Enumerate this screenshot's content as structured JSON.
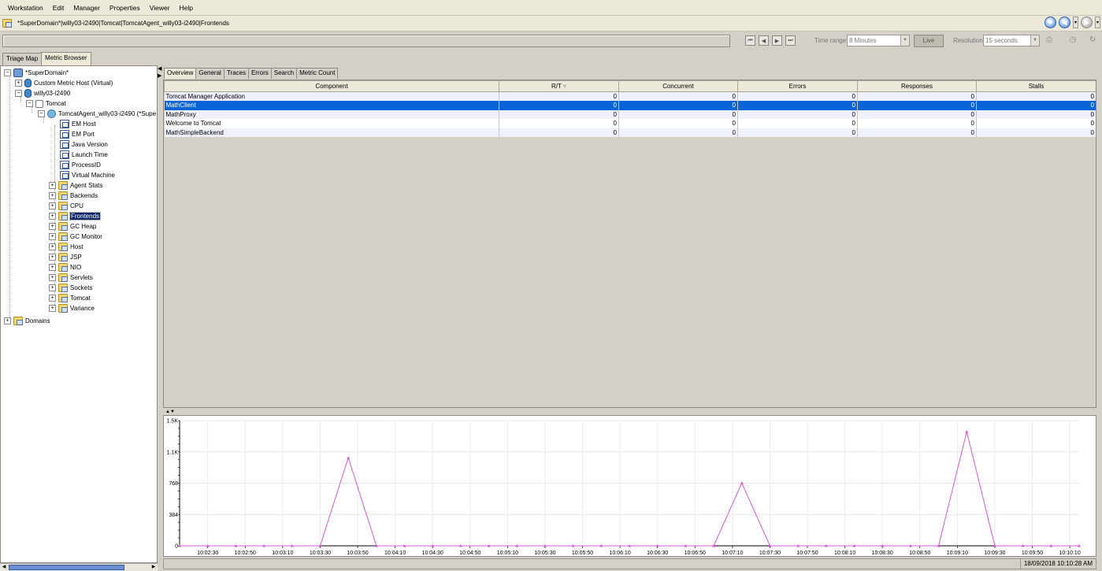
{
  "menubar": {
    "items": [
      "Workstation",
      "Edit",
      "Manager",
      "Properties",
      "Viewer",
      "Help"
    ]
  },
  "title_path": "*SuperDomain*|willy03-i2490|Tomcat|TomcatAgent_willy03-i2490|Frontends",
  "toolbar": {
    "time_range_label": "Time range:",
    "time_range_value": "8 Minutes",
    "live_label": "Live",
    "resolution_label": "Resolution:",
    "resolution_value": "15 seconds"
  },
  "left_tabs": [
    "Triage Map",
    "Metric Browser"
  ],
  "tree": {
    "root": "*SuperDomain*",
    "custom_host": "Custom Metric Host (Virtual)",
    "host": "willy03-i2490",
    "tomcat": "Tomcat",
    "agent": "TomcatAgent_willy03-i2490 (*Supe",
    "metrics": [
      "EM Host",
      "EM Port",
      "Java Version",
      "Launch Time",
      "ProcessID",
      "Virtual Machine"
    ],
    "folders": [
      "Agent Stats",
      "Backends",
      "CPU",
      "Frontends",
      "GC Heap",
      "GC Monitor",
      "Host",
      "JSP",
      "NIO",
      "Servlets",
      "Sockets",
      "Tomcat",
      "Variance"
    ],
    "selected_folder": "Frontends",
    "domains": "Domains"
  },
  "right_tabs": [
    "Overview",
    "General",
    "Traces",
    "Errors",
    "Search",
    "Metric Count"
  ],
  "table": {
    "headers": [
      "Component",
      "R/T",
      "Concurrent",
      "Errors",
      "Responses",
      "Stalls"
    ],
    "rows": [
      [
        "Tomcat Manager Application",
        "0",
        "0",
        "0",
        "0",
        "0"
      ],
      [
        "MathClient",
        "0",
        "0",
        "0",
        "0",
        "0"
      ],
      [
        "MathProxy",
        "0",
        "0",
        "0",
        "0",
        "0"
      ],
      [
        "Welcome to Tomcat",
        "0",
        "0",
        "0",
        "0",
        "0"
      ],
      [
        "MathSimpleBackend",
        "0",
        "0",
        "0",
        "0",
        "0"
      ]
    ],
    "selected_row": 1,
    "sort_indicator": "▿"
  },
  "chart_data": {
    "type": "line",
    "y_ticks": [
      "0",
      "384",
      "768",
      "1.1K",
      "1.5K"
    ],
    "ylim": [
      0,
      1536
    ],
    "x_ticks": [
      "10:02:30",
      "10:02:50",
      "10:03:10",
      "10:03:30",
      "10:03:50",
      "10:04:10",
      "10:04:30",
      "10:04:50",
      "10:05:10",
      "10:05:30",
      "10:05:50",
      "10:06:10",
      "10:06:30",
      "10:06:50",
      "10:07:10",
      "10:07:30",
      "10:07:50",
      "10:08:10",
      "10:08:30",
      "10:08:50",
      "10:09:10",
      "10:09:30",
      "10:09:50",
      "10:10:10"
    ],
    "series": [
      {
        "color": "#d65ad6",
        "x": [
          "10:02:15",
          "10:02:30",
          "10:02:45",
          "10:03:00",
          "10:03:15",
          "10:03:30",
          "10:03:45",
          "10:04:00",
          "10:04:15",
          "10:04:30",
          "10:04:45",
          "10:05:00",
          "10:05:15",
          "10:05:30",
          "10:05:45",
          "10:06:00",
          "10:06:15",
          "10:06:30",
          "10:06:45",
          "10:07:00",
          "10:07:15",
          "10:07:30",
          "10:07:45",
          "10:08:00",
          "10:08:15",
          "10:08:30",
          "10:08:45",
          "10:09:00",
          "10:09:15",
          "10:09:30",
          "10:09:45",
          "10:10:00",
          "10:10:15"
        ],
        "values": [
          0,
          0,
          0,
          0,
          0,
          0,
          1080,
          0,
          0,
          0,
          0,
          0,
          0,
          0,
          0,
          0,
          0,
          0,
          0,
          0,
          770,
          0,
          0,
          0,
          0,
          0,
          0,
          0,
          1400,
          0,
          0,
          0,
          0
        ]
      }
    ],
    "grid": true
  },
  "status_time": "18/09/2018 10:10:28 AM"
}
